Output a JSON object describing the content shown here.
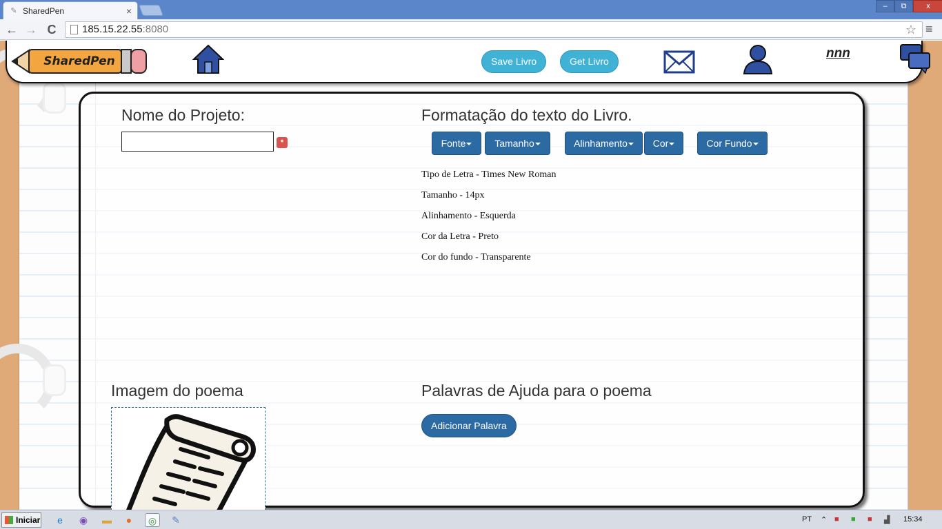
{
  "browser": {
    "tab_title": "SharedPen",
    "tab_close": "×",
    "url_host": "185.15.22.55",
    "url_port": ":8080",
    "back": "←",
    "forward": "→",
    "reload": "C",
    "star": "☆",
    "menu": "≡",
    "win_min": "–",
    "win_max": "⧉",
    "win_close": "x"
  },
  "header": {
    "logo_text": "SharedPen",
    "save_label": "Save Livro",
    "get_label": "Get Livro",
    "username": "nnn",
    "icons": [
      "home-icon",
      "mail-icon",
      "user-icon",
      "chat-icon"
    ]
  },
  "project": {
    "title": "Nome do Projeto:",
    "input_value": "",
    "required_mark": "*"
  },
  "formatting": {
    "title": "Formatação do texto do Livro.",
    "buttons": [
      "Fonte",
      "Tamanho",
      "Alinhamento",
      "Cor",
      "Cor Fundo"
    ],
    "lines": [
      "Tipo de Letra - Times New Roman",
      "Tamanho - 14px",
      "Alinhamento - Esquerda",
      "Cor da Letra - Preto",
      "Cor do fundo - Transparente"
    ]
  },
  "poem_image": {
    "title": "Imagem do poema",
    "icon": "scroll-icon"
  },
  "help_words": {
    "title": "Palavras de Ajuda para o poema",
    "add_label": "Adicionar Palavra"
  },
  "taskbar": {
    "start_label": "Iniciar",
    "lang": "PT",
    "time": "15:34",
    "icons": [
      "ie-icon",
      "viber-icon",
      "folder-icon",
      "firefox-icon",
      "chrome-icon",
      "paint-icon"
    ]
  },
  "colors": {
    "accent_pill": "#3fb2d6",
    "button_blue": "#2c6aa3",
    "page_border": "#e0a978",
    "required_red": "#d9534f"
  }
}
